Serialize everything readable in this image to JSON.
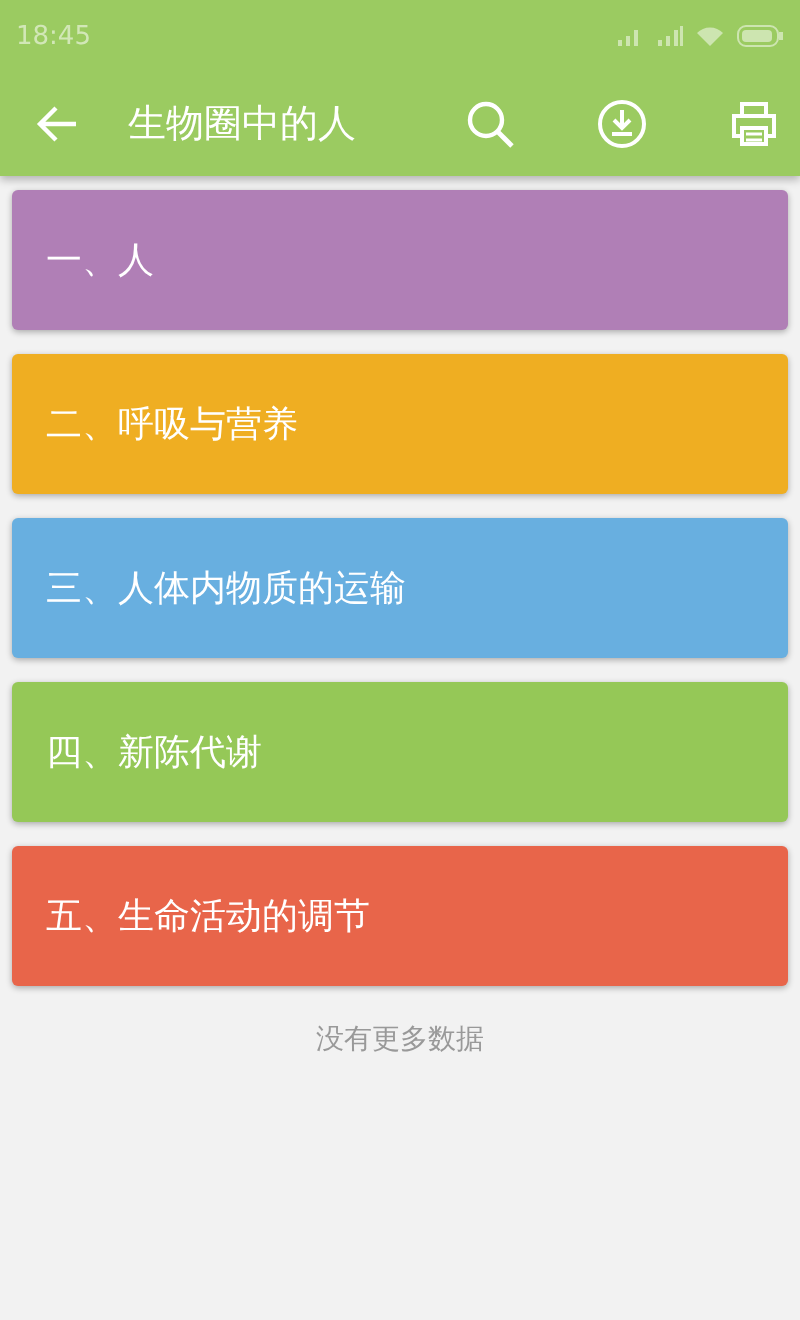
{
  "status_bar": {
    "time": "18:45"
  },
  "toolbar": {
    "title": "生物圈中的人"
  },
  "chapters": [
    {
      "title": "一、人",
      "color": "#b07fb6"
    },
    {
      "title": "二、呼吸与营养",
      "color": "#efae22"
    },
    {
      "title": "三、人体内物质的运输",
      "color": "#68afe0"
    },
    {
      "title": "四、新陈代谢",
      "color": "#95c857"
    },
    {
      "title": "五、生命活动的调节",
      "color": "#e8654a"
    }
  ],
  "footer": "没有更多数据"
}
